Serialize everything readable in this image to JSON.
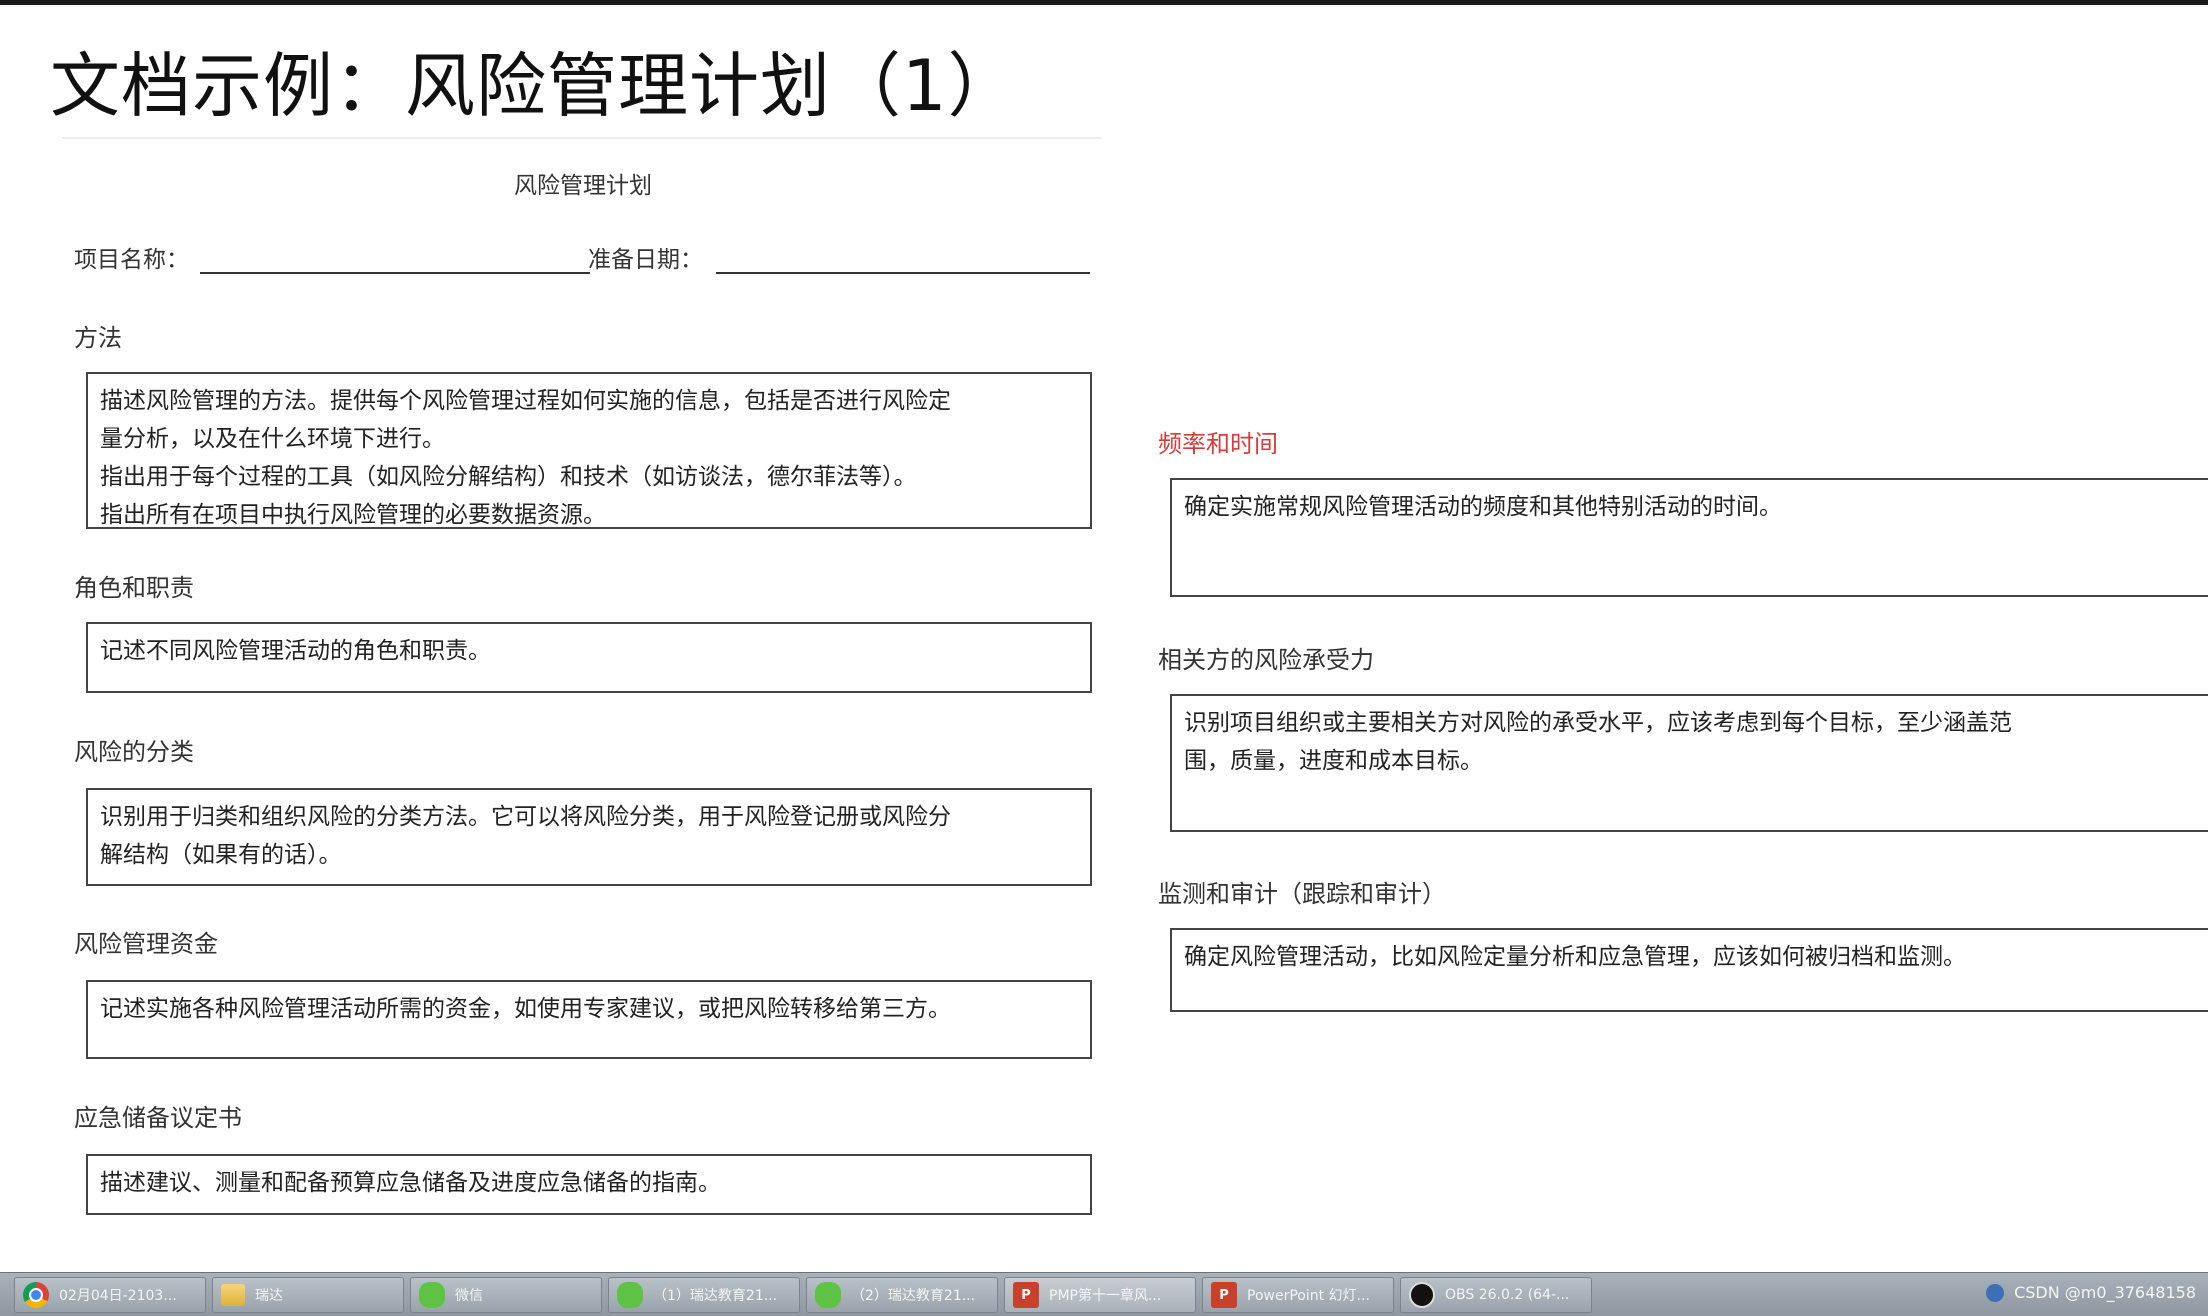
{
  "slide": {
    "title": "文档示例：风险管理计划（1）"
  },
  "document": {
    "title": "风险管理计划",
    "project_name_label": "项目名称：",
    "prepare_date_label": "准备日期："
  },
  "sections_left": [
    {
      "label": "方法",
      "lines": [
        "描述风险管理的方法。提供每个风险管理过程如何实施的信息，包括是否进行风险定",
        "量分析，以及在什么环境下进行。",
        "指出用于每个过程的工具（如风险分解结构）和技术（如访谈法，德尔菲法等）。",
        "指出所有在项目中执行风险管理的必要数据资源。"
      ]
    },
    {
      "label": "角色和职责",
      "lines": [
        "记述不同风险管理活动的角色和职责。"
      ]
    },
    {
      "label": "风险的分类",
      "lines": [
        "识别用于归类和组织风险的分类方法。它可以将风险分类，用于风险登记册或风险分",
        "解结构（如果有的话）。"
      ]
    },
    {
      "label": "风险管理资金",
      "lines": [
        "记述实施各种风险管理活动所需的资金，如使用专家建议，或把风险转移给第三方。"
      ]
    },
    {
      "label": "应急储备议定书",
      "lines": [
        "描述建议、测量和配备预算应急储备及进度应急储备的指南。"
      ]
    }
  ],
  "sections_right": [
    {
      "label": "频率和时间",
      "lines": [
        "确定实施常规风险管理活动的频度和其他特别活动的时间。"
      ]
    },
    {
      "label": "相关方的风险承受力",
      "lines": [
        "识别项目组织或主要相关方对风险的承受水平，应该考虑到每个目标，至少涵盖范",
        "围，质量，进度和成本目标。"
      ]
    },
    {
      "label": "监测和审计（跟踪和审计）",
      "lines": [
        "确定风险管理活动，比如风险定量分析和应急管理，应该如何被归档和监测。"
      ]
    }
  ],
  "colors": {
    "highlight_label": "#d63c3c"
  },
  "taskbar": {
    "items": [
      {
        "icon": "chrome-icon",
        "label": "02月04日-2103..."
      },
      {
        "icon": "folder-icon",
        "label": "瑞达"
      },
      {
        "icon": "wechat-icon",
        "label": "微信"
      },
      {
        "icon": "wechat-icon",
        "label": "（1）瑞达教育21..."
      },
      {
        "icon": "wechat-icon",
        "label": "（2）瑞达教育21..."
      },
      {
        "icon": "powerpoint-icon",
        "label": "PMP第十一章风..."
      },
      {
        "icon": "powerpoint-icon",
        "label": "PowerPoint 幻灯..."
      },
      {
        "icon": "obs-icon",
        "label": "OBS 26.0.2 (64-..."
      }
    ],
    "tray_text": "CSDN @m0_37648158"
  }
}
